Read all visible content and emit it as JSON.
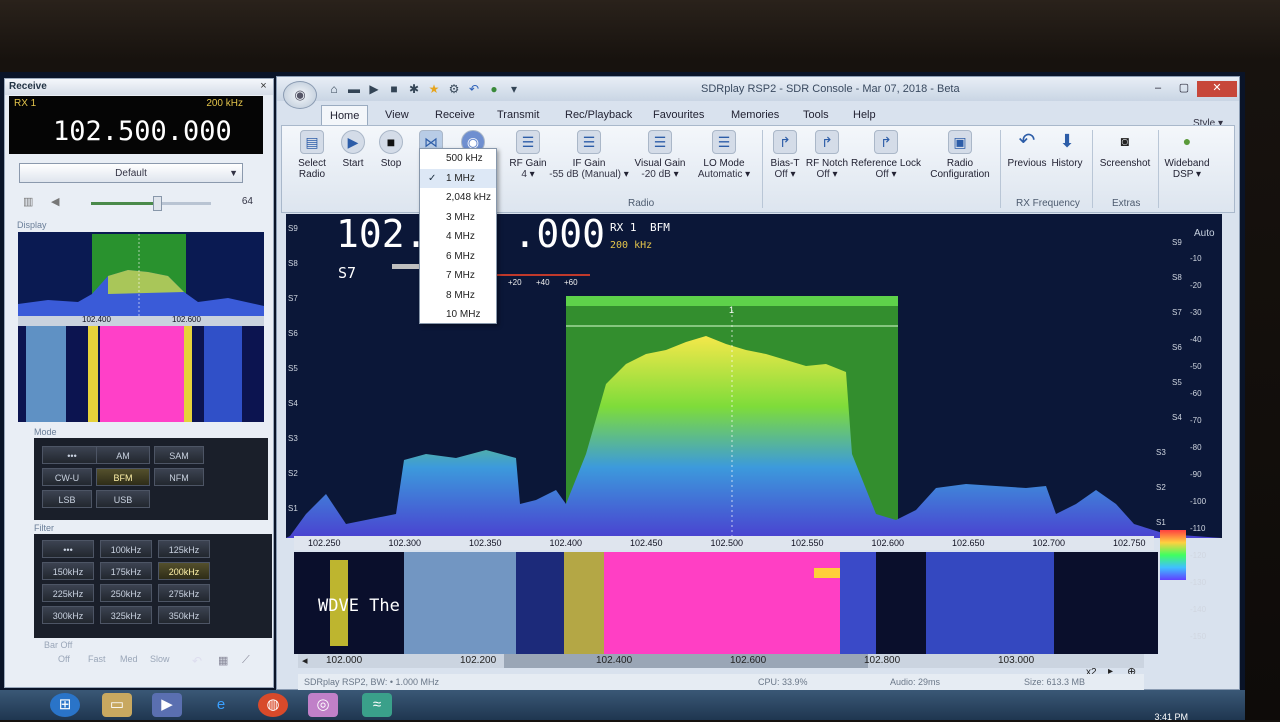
{
  "receive_panel": {
    "title": "Receive",
    "close": "×",
    "rx": "RX 1",
    "bandwidth": "200 kHz",
    "frequency": "102.500.000",
    "preset": "Default",
    "volume_value": "64",
    "volume_level": 0.55,
    "display_header": "Display",
    "mini_axis": [
      "102.400",
      "102.600"
    ],
    "mode_header": "Mode",
    "modes": [
      "•••",
      "AM",
      "SAM",
      "CW-U",
      "BFM",
      "NFM",
      "LSB",
      "USB"
    ],
    "active_mode": "BFM",
    "filter_header": "Filter",
    "filters": [
      "•••",
      "100kHz",
      "125kHz",
      "150kHz",
      "175kHz",
      "200kHz",
      "225kHz",
      "250kHz",
      "275kHz",
      "300kHz",
      "325kHz",
      "350kHz"
    ],
    "active_filter": "200kHz",
    "bottom_label": "Bar Off",
    "bottom_row": [
      "Off",
      "Fast",
      "Med",
      "Slow"
    ]
  },
  "window": {
    "title": "SDRplay RSP2 - SDR Console - Mar 07, 2018 - Beta",
    "controls": [
      "–",
      "▢",
      "✕"
    ]
  },
  "tabs": [
    "Home",
    "View",
    "Receive",
    "Transmit",
    "Rec/Playback",
    "Favourites",
    "Memories",
    "Tools",
    "Help"
  ],
  "active_tab": "Home",
  "style_label": "Style",
  "ribbon": {
    "select_radio": [
      "Select",
      "Radio"
    ],
    "start": "Start",
    "stop": "Stop",
    "rf_gain": [
      "RF Gain",
      "4"
    ],
    "if_gain": [
      "IF Gain",
      "-55 dB (Manual)"
    ],
    "visual_gain": [
      "Visual Gain",
      "-20 dB"
    ],
    "lo_mode": [
      "LO Mode",
      "Automatic"
    ],
    "bias_t": [
      "Bias-T",
      "Off"
    ],
    "rf_notch": [
      "RF Notch",
      "Off"
    ],
    "ref_lock": [
      "Reference Lock",
      "Off"
    ],
    "radio_config": [
      "Radio",
      "Configuration"
    ],
    "previous": "Previous",
    "history": "History",
    "screenshot": "Screenshot",
    "wideband": [
      "Wideband",
      "DSP"
    ],
    "group_radio": "Radio",
    "group_rx_freq": "RX Frequency",
    "group_extras": "Extras"
  },
  "bandwidth_dropdown": {
    "options": [
      "500 kHz",
      "1 MHz",
      "2,048 kHz",
      "3 MHz",
      "4 MHz",
      "6 MHz",
      "7 MHz",
      "8 MHz",
      "10 MHz"
    ],
    "checked": "1 MHz"
  },
  "display": {
    "frequency": "102.500.000",
    "frequency_shown": [
      "102.",
      ".000"
    ],
    "rx": "RX 1",
    "mode": "BFM",
    "bandwidth": "200 kHz",
    "smeter": "S7",
    "smeter_scale": [
      "+20",
      "+40",
      "+60"
    ],
    "signal_marker": "1",
    "auto": "Auto",
    "left_scale": [
      "S9",
      "S8",
      "S7",
      "S6",
      "S5",
      "S4",
      "S3",
      "S2",
      "S1"
    ],
    "right_scale_s": [
      "S9",
      "S8",
      "S7",
      "S6",
      "S5",
      "S4",
      "S3",
      "S2",
      "S1"
    ],
    "right_scale_db": [
      "-10",
      "-20",
      "-30",
      "-40",
      "-50",
      "-60",
      "-70",
      "-80",
      "-90",
      "-100",
      "-110",
      "-120",
      "-130",
      "-140",
      "-150"
    ],
    "freq_axis": [
      "102.250",
      "102.300",
      "102.350",
      "102.400",
      "102.450",
      "102.500",
      "102.550",
      "102.600",
      "102.650",
      "102.700",
      "102.750"
    ],
    "waterfall_text": "WDVE The",
    "nav_axis": [
      "102.000",
      "102.200",
      "102.400",
      "102.600",
      "102.800",
      "103.000"
    ],
    "zoom": "x2"
  },
  "status": {
    "left": "SDRplay RSP2, BW: • 1.000 MHz",
    "cpu": "CPU: 33.9%",
    "audio": "Audio: 29ms",
    "size": "Size: 613.3 MB"
  },
  "taskbar": {
    "clock": "3:41 PM"
  }
}
